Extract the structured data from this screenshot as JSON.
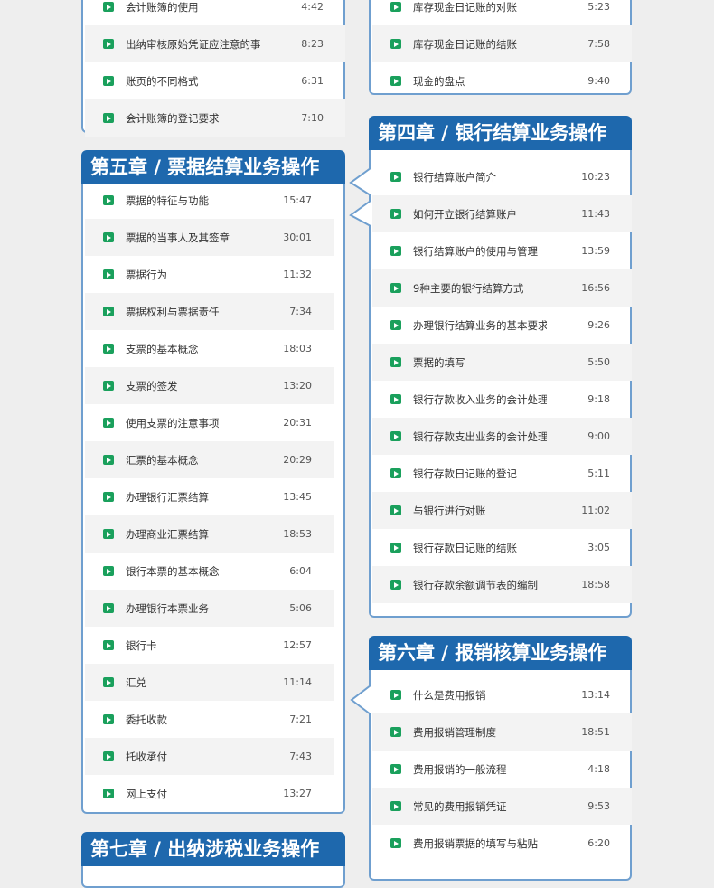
{
  "colors": {
    "header_bg": "#1e68ad",
    "border": "#6f9fcf",
    "play_icon": "#1aa05c",
    "page_bg": "#eeeeee"
  },
  "chapter3": {
    "lessons": [
      {
        "title": "会计账簿的使用",
        "duration": "4:42"
      },
      {
        "title": "出纳审核原始凭证应注意的事项",
        "duration": "8:23"
      },
      {
        "title": "账页的不同格式",
        "duration": "6:31"
      },
      {
        "title": "会计账簿的登记要求",
        "duration": "7:10"
      }
    ]
  },
  "chapter3b": {
    "lessons": [
      {
        "title": "库存现金日记账的对账",
        "duration": "5:23"
      },
      {
        "title": "库存现金日记账的结账",
        "duration": "7:58"
      },
      {
        "title": "现金的盘点",
        "duration": "9:40"
      }
    ]
  },
  "chapter4": {
    "title": "第四章 / 银行结算业务操作",
    "lessons": [
      {
        "title": "银行结算账户简介",
        "duration": "10:23"
      },
      {
        "title": "如何开立银行结算账户",
        "duration": "11:43"
      },
      {
        "title": "银行结算账户的使用与管理",
        "duration": "13:59"
      },
      {
        "title": "9种主要的银行结算方式",
        "duration": "16:56"
      },
      {
        "title": "办理银行结算业务的基本要求",
        "duration": "9:26"
      },
      {
        "title": "票据的填写",
        "duration": "5:50"
      },
      {
        "title": "银行存款收入业务的会计处理",
        "duration": "9:18"
      },
      {
        "title": "银行存款支出业务的会计处理",
        "duration": "9:00"
      },
      {
        "title": "银行存款日记账的登记",
        "duration": "5:11"
      },
      {
        "title": "与银行进行对账",
        "duration": "11:02"
      },
      {
        "title": "银行存款日记账的结账",
        "duration": "3:05"
      },
      {
        "title": "银行存款余额调节表的编制",
        "duration": "18:58"
      }
    ]
  },
  "chapter5": {
    "title": "第五章 / 票据结算业务操作",
    "lessons": [
      {
        "title": "票据的特征与功能",
        "duration": "15:47"
      },
      {
        "title": "票据的当事人及其签章",
        "duration": "30:01"
      },
      {
        "title": "票据行为",
        "duration": "11:32"
      },
      {
        "title": "票据权利与票据责任",
        "duration": "7:34"
      },
      {
        "title": "支票的基本概念",
        "duration": "18:03"
      },
      {
        "title": "支票的签发",
        "duration": "13:20"
      },
      {
        "title": "使用支票的注意事项",
        "duration": "20:31"
      },
      {
        "title": "汇票的基本概念",
        "duration": "20:29"
      },
      {
        "title": "办理银行汇票结算",
        "duration": "13:45"
      },
      {
        "title": "办理商业汇票结算",
        "duration": "18:53"
      },
      {
        "title": "银行本票的基本概念",
        "duration": "6:04"
      },
      {
        "title": "办理银行本票业务",
        "duration": "5:06"
      },
      {
        "title": "银行卡",
        "duration": "12:57"
      },
      {
        "title": "汇兑",
        "duration": "11:14"
      },
      {
        "title": "委托收款",
        "duration": "7:21"
      },
      {
        "title": "托收承付",
        "duration": "7:43"
      },
      {
        "title": "网上支付",
        "duration": "13:27"
      }
    ]
  },
  "chapter6": {
    "title": "第六章 / 报销核算业务操作",
    "lessons": [
      {
        "title": "什么是费用报销",
        "duration": "13:14"
      },
      {
        "title": "费用报销管理制度",
        "duration": "18:51"
      },
      {
        "title": "费用报销的一般流程",
        "duration": "4:18"
      },
      {
        "title": "常见的费用报销凭证",
        "duration": "9:53"
      },
      {
        "title": "费用报销票据的填写与粘贴",
        "duration": "6:20"
      }
    ]
  },
  "chapter7": {
    "title": "第七章 / 出纳涉税业务操作"
  }
}
